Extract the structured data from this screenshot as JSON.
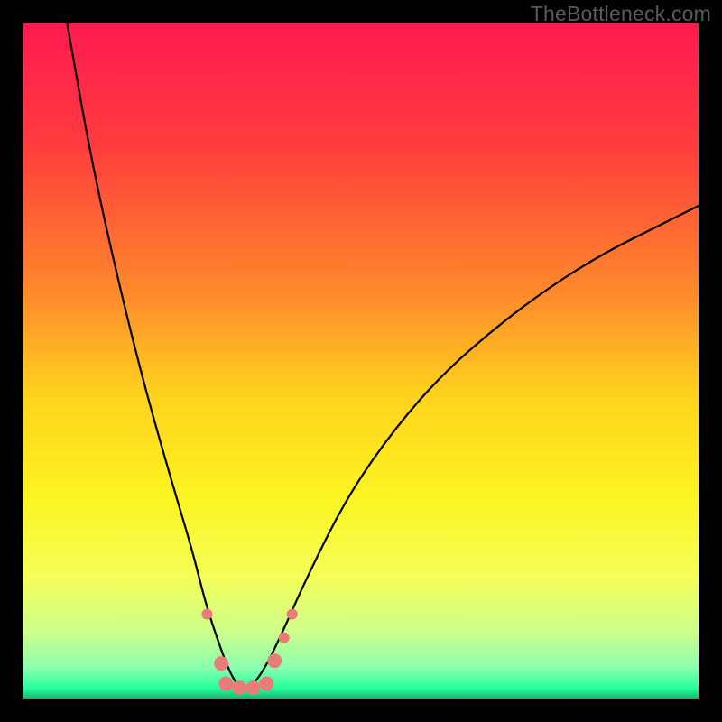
{
  "attribution": "TheBottleneck.com",
  "chart_data": {
    "type": "line",
    "title": "",
    "xlabel": "",
    "ylabel": "",
    "xlim": [
      0,
      100
    ],
    "ylim": [
      0,
      100
    ],
    "gradient_stops": [
      {
        "offset": 0,
        "color": "#ff1a50"
      },
      {
        "offset": 0.18,
        "color": "#ff3c3d"
      },
      {
        "offset": 0.4,
        "color": "#ff8a2b"
      },
      {
        "offset": 0.55,
        "color": "#ffd21e"
      },
      {
        "offset": 0.7,
        "color": "#fcf420"
      },
      {
        "offset": 0.82,
        "color": "#f4ff58"
      },
      {
        "offset": 0.9,
        "color": "#ceff8a"
      },
      {
        "offset": 0.955,
        "color": "#8affaf"
      },
      {
        "offset": 0.985,
        "color": "#24ff9d"
      },
      {
        "offset": 1.0,
        "color": "#18b56f"
      }
    ],
    "series": [
      {
        "name": "bottleneck-curve",
        "x": [
          6.5,
          10,
          14,
          18,
          22,
          25,
          27,
          29,
          30.5,
          32,
          33.5,
          35.5,
          38,
          42,
          48,
          55,
          62,
          70,
          78,
          86,
          94,
          100
        ],
        "y": [
          100,
          80,
          62,
          46,
          32,
          22,
          14,
          8,
          4,
          1.5,
          1.5,
          4,
          9,
          18,
          30,
          40,
          48,
          55,
          61,
          66,
          70,
          73
        ]
      }
    ],
    "markers": {
      "color": "#e77c79",
      "radius_small": 6,
      "radius_large": 8,
      "points": [
        {
          "x": 27.2,
          "y": 12.5,
          "r": "small"
        },
        {
          "x": 29.3,
          "y": 5.2,
          "r": "large"
        },
        {
          "x": 30.0,
          "y": 2.2,
          "r": "large"
        },
        {
          "x": 32.0,
          "y": 1.6,
          "r": "large"
        },
        {
          "x": 34.0,
          "y": 1.6,
          "r": "large"
        },
        {
          "x": 36.0,
          "y": 2.2,
          "r": "large"
        },
        {
          "x": 37.2,
          "y": 5.6,
          "r": "large"
        },
        {
          "x": 38.6,
          "y": 9.0,
          "r": "small"
        },
        {
          "x": 39.8,
          "y": 12.5,
          "r": "small"
        }
      ]
    }
  }
}
